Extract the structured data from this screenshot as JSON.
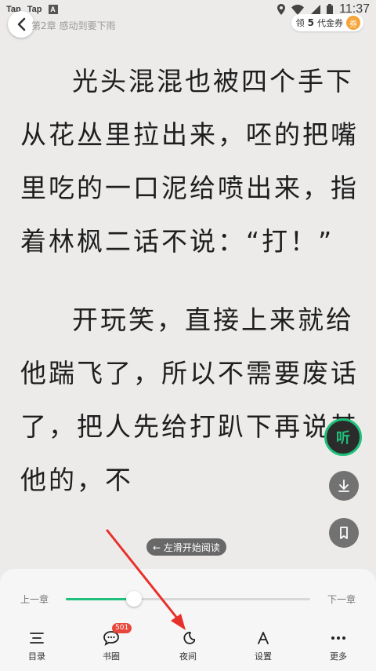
{
  "status_bar": {
    "app1": "Tap",
    "app2": "Tap",
    "app3": "A",
    "time": "11:37"
  },
  "header": {
    "chapter_title": "第2章 感动到要下雨",
    "coupon_prefix": "领",
    "coupon_count": "5",
    "coupon_suffix": "代金券",
    "coupon_badge": "券"
  },
  "reader": {
    "paragraphs": [
      "光头混混也被四个手下从花丛里拉出来，呸的把嘴里吃的一口泥给喷出来，指着林枫二话不说：“打！”",
      "开玩笑，直接上来就给他踹飞了，所以不需要废话了，把人先给打趴下再说其他的，不"
    ]
  },
  "floating": {
    "listen_label": "听",
    "swipe_hint": "← 左滑开始阅读"
  },
  "chapter_nav": {
    "prev_label": "上一章",
    "next_label": "下一章",
    "progress": 0.28
  },
  "toolbar": {
    "items": [
      {
        "label": "目录",
        "icon": "list-icon"
      },
      {
        "label": "书圈",
        "icon": "chat-bubble-icon",
        "badge": "501"
      },
      {
        "label": "夜间",
        "icon": "moon-icon"
      },
      {
        "label": "设置",
        "icon": "font-a-icon"
      },
      {
        "label": "更多",
        "icon": "more-dots-icon"
      }
    ]
  },
  "colors": {
    "accent": "#1fc07b",
    "badge": "#e8473b",
    "annotation": "#e8302a"
  }
}
